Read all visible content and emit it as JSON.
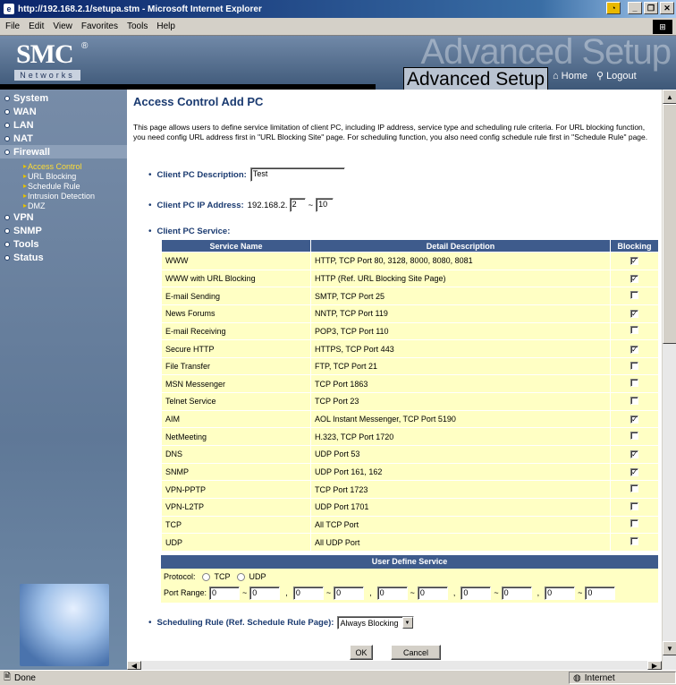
{
  "window": {
    "title": "http://192.168.2.1/setupa.stm - Microsoft Internet Explorer",
    "icon": "ie-icon"
  },
  "menubar": {
    "items": [
      "File",
      "Edit",
      "View",
      "Favorites",
      "Tools",
      "Help"
    ]
  },
  "header": {
    "logo": "SMC",
    "logo_reg": "®",
    "logo_sub": "Networks",
    "watermark": "Advanced Setup",
    "title": "Advanced Setup",
    "home": "Home",
    "logout": "Logout"
  },
  "sidebar": {
    "items": [
      {
        "label": "System",
        "active": false
      },
      {
        "label": "WAN",
        "active": false
      },
      {
        "label": "LAN",
        "active": false
      },
      {
        "label": "NAT",
        "active": false
      },
      {
        "label": "Firewall",
        "active": true
      },
      {
        "label": "VPN",
        "active": false
      },
      {
        "label": "SNMP",
        "active": false
      },
      {
        "label": "Tools",
        "active": false
      },
      {
        "label": "Status",
        "active": false
      }
    ],
    "firewall_sub": [
      "Access Control",
      "URL Blocking",
      "Schedule Rule",
      "Intrusion Detection",
      "DMZ"
    ]
  },
  "page": {
    "title": "Access Control Add PC",
    "description": "This page allows users to define service limitation of client PC, including IP address, service type and scheduling rule criteria. For URL blocking function, you need config URL address first in \"URL Blocking Site\" page. For scheduling function, you also need config schedule rule first in \"Schedule Rule\" page.",
    "client_desc_label": "Client PC Description:",
    "client_desc_value": "Test",
    "client_ip_label": "Client PC IP Address:",
    "ip_prefix": "192.168.2.",
    "ip_from": "2",
    "ip_sep": "~",
    "ip_to": "10",
    "service_label": "Client PC Service:",
    "table_headers": [
      "Service Name",
      "Detail Description",
      "Blocking"
    ],
    "services": [
      {
        "name": "WWW",
        "desc": "HTTP, TCP Port 80, 3128, 8000, 8080, 8081",
        "checked": true
      },
      {
        "name": "WWW with URL Blocking",
        "desc": "HTTP (Ref. URL Blocking Site Page)",
        "checked": true
      },
      {
        "name": "E-mail Sending",
        "desc": "SMTP, TCP Port 25",
        "checked": false
      },
      {
        "name": "News Forums",
        "desc": "NNTP, TCP Port 119",
        "checked": true
      },
      {
        "name": "E-mail Receiving",
        "desc": "POP3, TCP Port 110",
        "checked": false
      },
      {
        "name": "Secure HTTP",
        "desc": "HTTPS, TCP Port 443",
        "checked": true
      },
      {
        "name": "File Transfer",
        "desc": "FTP, TCP Port 21",
        "checked": false
      },
      {
        "name": "MSN Messenger",
        "desc": "TCP Port 1863",
        "checked": false
      },
      {
        "name": "Telnet Service",
        "desc": "TCP Port 23",
        "checked": false
      },
      {
        "name": "AIM",
        "desc": "AOL Instant Messenger, TCP Port 5190",
        "checked": true
      },
      {
        "name": "NetMeeting",
        "desc": "H.323, TCP Port 1720",
        "checked": false
      },
      {
        "name": "DNS",
        "desc": "UDP Port 53",
        "checked": true
      },
      {
        "name": "SNMP",
        "desc": "UDP Port 161, 162",
        "checked": true
      },
      {
        "name": "VPN-PPTP",
        "desc": "TCP Port 1723",
        "checked": false
      },
      {
        "name": "VPN-L2TP",
        "desc": "UDP Port 1701",
        "checked": false
      },
      {
        "name": "TCP",
        "desc": "All TCP Port",
        "checked": false
      },
      {
        "name": "UDP",
        "desc": "All UDP Port",
        "checked": false
      }
    ],
    "udef_title": "User Define Service",
    "protocol_label": "Protocol:",
    "protocol_options": [
      "TCP",
      "UDP"
    ],
    "port_range_label": "Port Range:",
    "port_sep": "~",
    "port_comma": ",",
    "port_values": [
      "0",
      "0"
    ],
    "sched_label": "Scheduling Rule (Ref. Schedule Rule Page):",
    "sched_value": "Always Blocking",
    "ok": "OK",
    "cancel": "Cancel"
  },
  "status": {
    "left": "Done",
    "zone": "Internet"
  },
  "colors": {
    "accent": "#3e5b8c",
    "row_bg": "#ffffc4",
    "title": "#1a3a70"
  }
}
